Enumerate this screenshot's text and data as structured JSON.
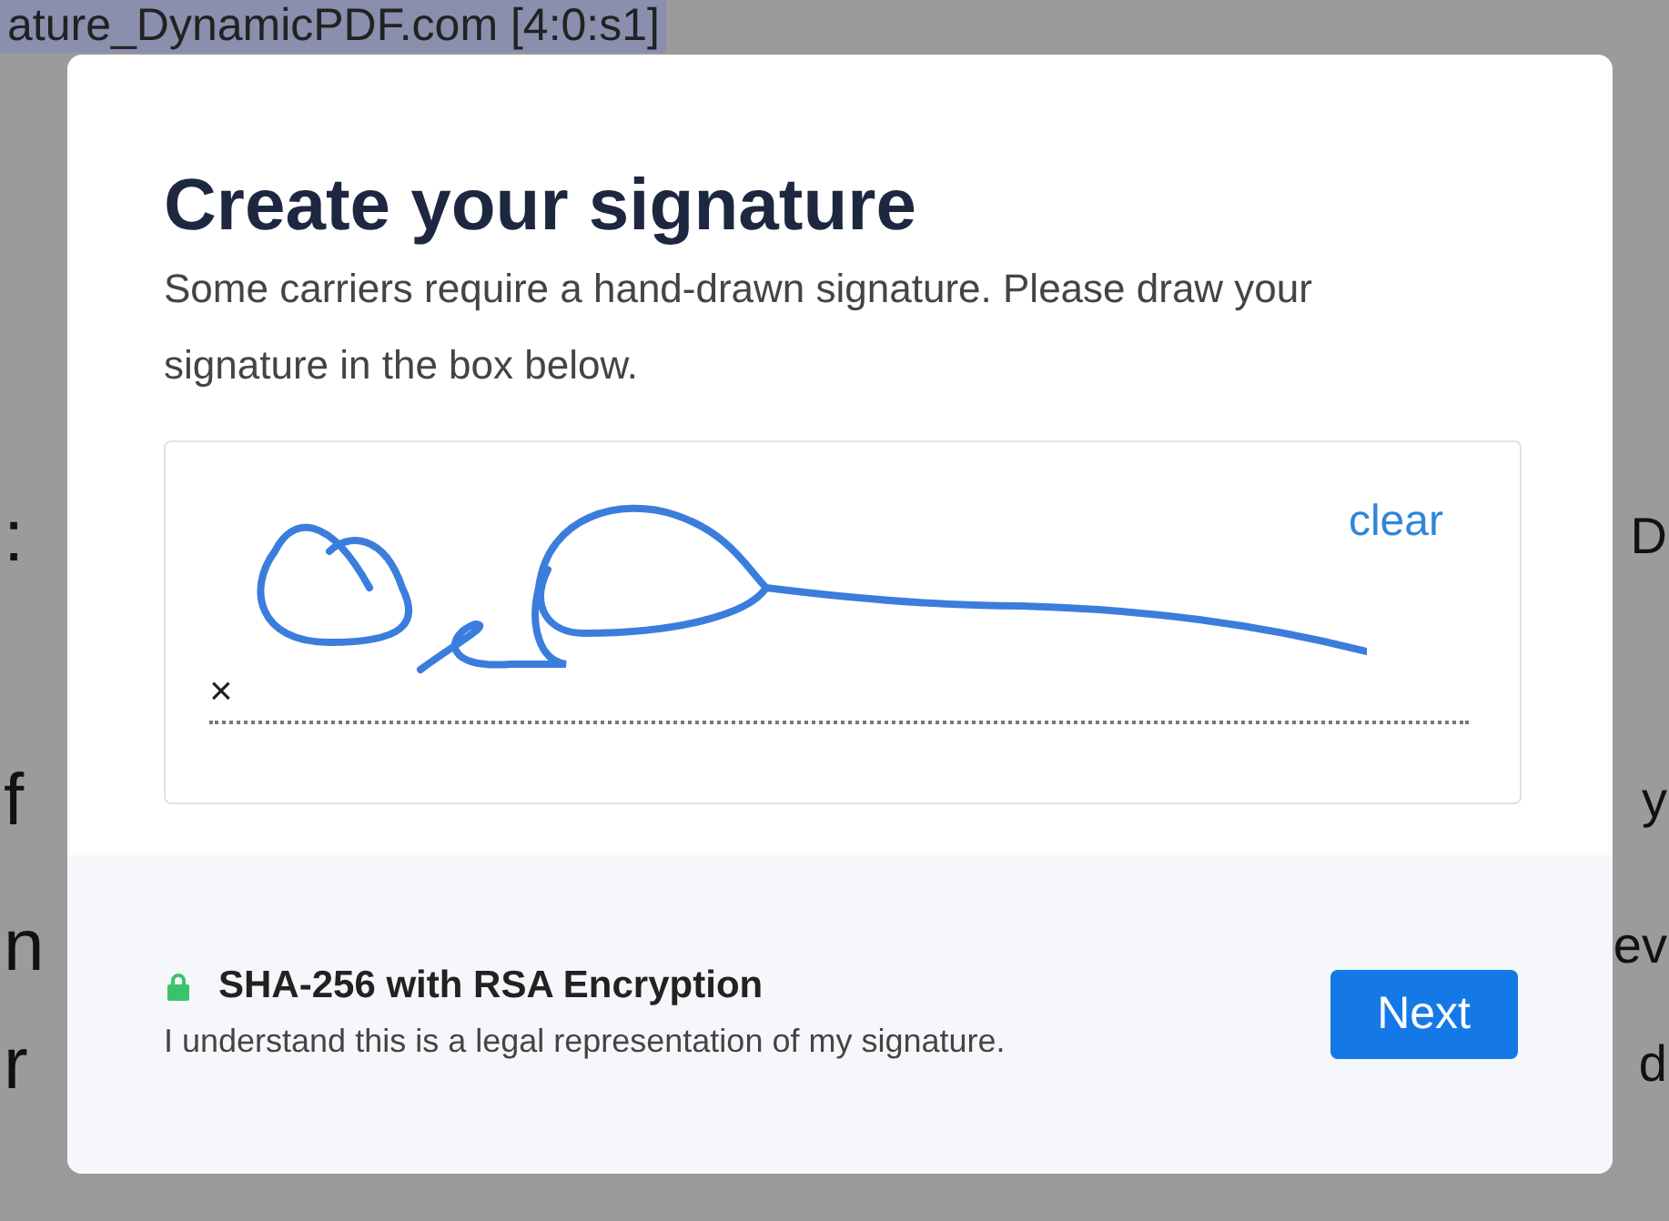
{
  "background": {
    "header": "ature_DynamicPDF.com [4:0:s1]",
    "left_fragments": [
      ":",
      "f",
      "n",
      "r"
    ],
    "right_fragments": [
      "D",
      "y",
      "ev",
      "d"
    ]
  },
  "dialog": {
    "title": "Create your signature",
    "description": "Some carriers require a hand-drawn signature. Please draw your signature in the box below.",
    "signature_box": {
      "clear": "clear",
      "sign_mark": "×"
    },
    "footer": {
      "security": "SHA-256 with RSA Encryption",
      "notice": "I understand this is a legal representation of my signature.",
      "button": "Next"
    }
  }
}
